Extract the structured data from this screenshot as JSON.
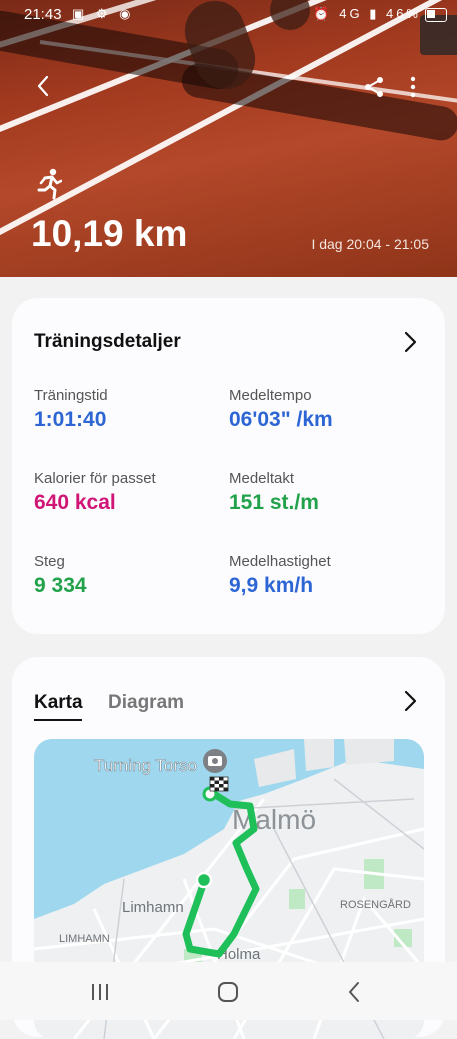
{
  "status_bar": {
    "time": "21:43",
    "battery": "46%",
    "network": "4G"
  },
  "header": {
    "distance": "10,19 km",
    "time_range": "I dag 20:04 - 21:05"
  },
  "details_card": {
    "title": "Träningsdetaljer",
    "metrics": [
      {
        "label": "Träningstid",
        "value": "1:01:40",
        "color": "#2d66d4"
      },
      {
        "label": "Medeltempo",
        "value": "06'03\" /km",
        "color": "#2d66d4"
      },
      {
        "label": "Kalorier för passet",
        "value": "640 kcal",
        "color": "#d01577"
      },
      {
        "label": "Medeltakt",
        "value": "151 st./m",
        "color": "#21a24a"
      },
      {
        "label": "Steg",
        "value": "9 334",
        "color": "#21a24a"
      },
      {
        "label": "Medelhastighet",
        "value": "9,9 km/h",
        "color": "#2d66d4"
      }
    ]
  },
  "map_card": {
    "tabs": [
      {
        "label": "Karta",
        "active": true
      },
      {
        "label": "Diagram",
        "active": false
      }
    ],
    "map_labels": {
      "turning_torso": "Turning Torso",
      "malmo": "Malmö",
      "limhamn": "Limhamn",
      "limhamn_upper": "LIMHAMN",
      "rosengard": "ROSENGÅRD",
      "holma": "Holma"
    },
    "route_color": "#1fbf5a"
  }
}
